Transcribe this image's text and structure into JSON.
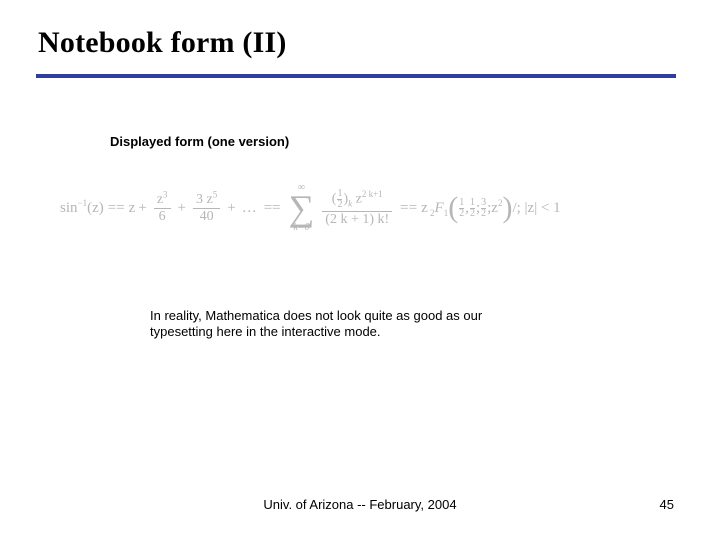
{
  "title": "Notebook form (II)",
  "subhead": "Displayed form  (one version)",
  "formula": {
    "lhs_base": "sin",
    "lhs_exp": "−1",
    "lhs_arg": "(z)",
    "eq": "==",
    "term1": "z",
    "plus": "+",
    "frac1": {
      "num": "z",
      "num_exp": "3",
      "den": "6"
    },
    "frac2": {
      "num_coef": "3 ",
      "num_var": "z",
      "num_exp": "5",
      "den": "40"
    },
    "ellipsis": "…",
    "sum": {
      "upper": "∞",
      "sigma": "∑",
      "lower_var": "k",
      "lower_eq": "=0"
    },
    "sumfrac": {
      "num_open": "(",
      "num_half_n": "1",
      "num_half_d": "2",
      "num_close": ")",
      "num_sub": "k",
      "num_z": " z",
      "num_exp": "2 k+1",
      "den": "(2 k + 1) k!"
    },
    "tail_eq2": "==",
    "tail_z": "z",
    "tail_sub": " 2",
    "tail_F": "F",
    "tail_F_sub": "1",
    "hyp_open": "(",
    "hyp_a_n": "1",
    "hyp_a_d": "2",
    "hyp_sep1": ", ",
    "hyp_b_n": "1",
    "hyp_b_d": "2",
    "hyp_semicolon": "; ",
    "hyp_c_n": "3",
    "hyp_c_d": "2",
    "hyp_semicolon2": "; ",
    "hyp_z2": "z",
    "hyp_z2_exp": "2",
    "hyp_close": ")",
    "cond": " /; |z| < 1"
  },
  "note": "In reality, Mathematica does not look quite as good as our typesetting here in the interactive mode.",
  "footer_center": "Univ. of Arizona -- February, 2004",
  "footer_right": "45"
}
